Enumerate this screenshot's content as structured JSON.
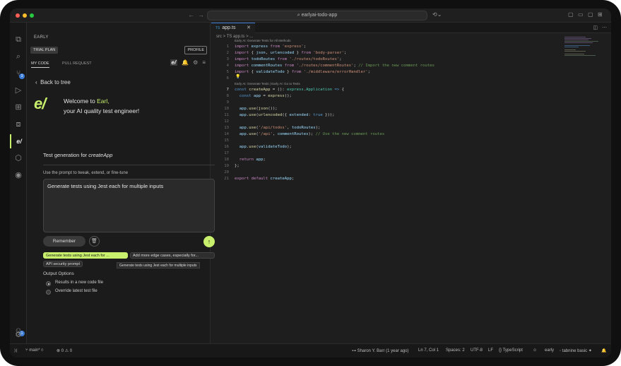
{
  "window": {
    "title": "earlyai-todo-app",
    "traffic_colors": [
      "#ff5f57",
      "#febc2e",
      "#28c840"
    ]
  },
  "activity_bar": {
    "items": [
      {
        "icon": "files-icon",
        "glyph": "⧉"
      },
      {
        "icon": "search-icon",
        "glyph": "⌕"
      },
      {
        "icon": "source-control-icon",
        "glyph": "⑂",
        "badge": "3"
      },
      {
        "icon": "run-debug-icon",
        "glyph": "▷"
      },
      {
        "icon": "extensions-icon",
        "glyph": "⊞"
      },
      {
        "icon": "remote-icon",
        "glyph": "⧈"
      },
      {
        "icon": "early-icon",
        "glyph": "e/"
      },
      {
        "icon": "package-icon",
        "glyph": "⬡"
      },
      {
        "icon": "tabnine-icon",
        "glyph": "◉"
      }
    ],
    "account_badge": "1"
  },
  "sidebar": {
    "title": "EARLY",
    "trial_badge": "TRIAL PLAN",
    "profile_button": "PROFILE",
    "tabs": [
      "MY CODE",
      "PULL REQUEST"
    ],
    "logo_badge": "e/",
    "back_link": "Back to tree",
    "logo_text": "e/",
    "welcome_prefix": "Welcome to ",
    "welcome_name": "Earl,",
    "welcome_line2": "your AI quality test engineer!",
    "test_gen_prefix": "Test generation for ",
    "test_gen_target": "createApp",
    "prompt_label": "Use the prompt to tweak, extend, or fine-tune",
    "prompt_value": "Generate tests using Jest each for multiple inputs",
    "remember_button": "Remember",
    "chips": [
      "Generate tests using Jest each for ...",
      "Add more edge cases, especially for...",
      "API security prompt"
    ],
    "tooltip": "Generate tests using Jest each for multiple inputs",
    "output_title": "Output Options",
    "options": [
      {
        "label": "Results in a new code file",
        "selected": true
      },
      {
        "label": "Override latest test file",
        "selected": false
      }
    ]
  },
  "editor": {
    "tab_lang": "TS",
    "tab_name": "app.ts",
    "breadcrumb": "src  >  TS app.ts  >  ...",
    "lens1": "Early AI: Generate Tests for All Methods",
    "lens2": "Early AI: Generate Tests | Early AI: Go to Tests",
    "line_numbers": [
      "1",
      "2",
      "3",
      "4",
      "5",
      "6",
      "7",
      "8",
      "9",
      "10",
      "11",
      "12",
      "13",
      "14",
      "15",
      "16",
      "17",
      "18",
      "19",
      "20",
      "21"
    ],
    "current_line": "7"
  },
  "status_bar": {
    "branch": "main*",
    "problems": "⊗ 0 ⚠ 0",
    "blame": "Sharon Y. Barr (1 year ago)",
    "cursor": "Ln 7, Col 1",
    "spaces": "Spaces: 2",
    "encoding": "UTF-8",
    "eol": "LF",
    "language": "TypeScript",
    "early": "early",
    "tabnine": "tabnine basic"
  },
  "accent_color": "#c8f06c"
}
